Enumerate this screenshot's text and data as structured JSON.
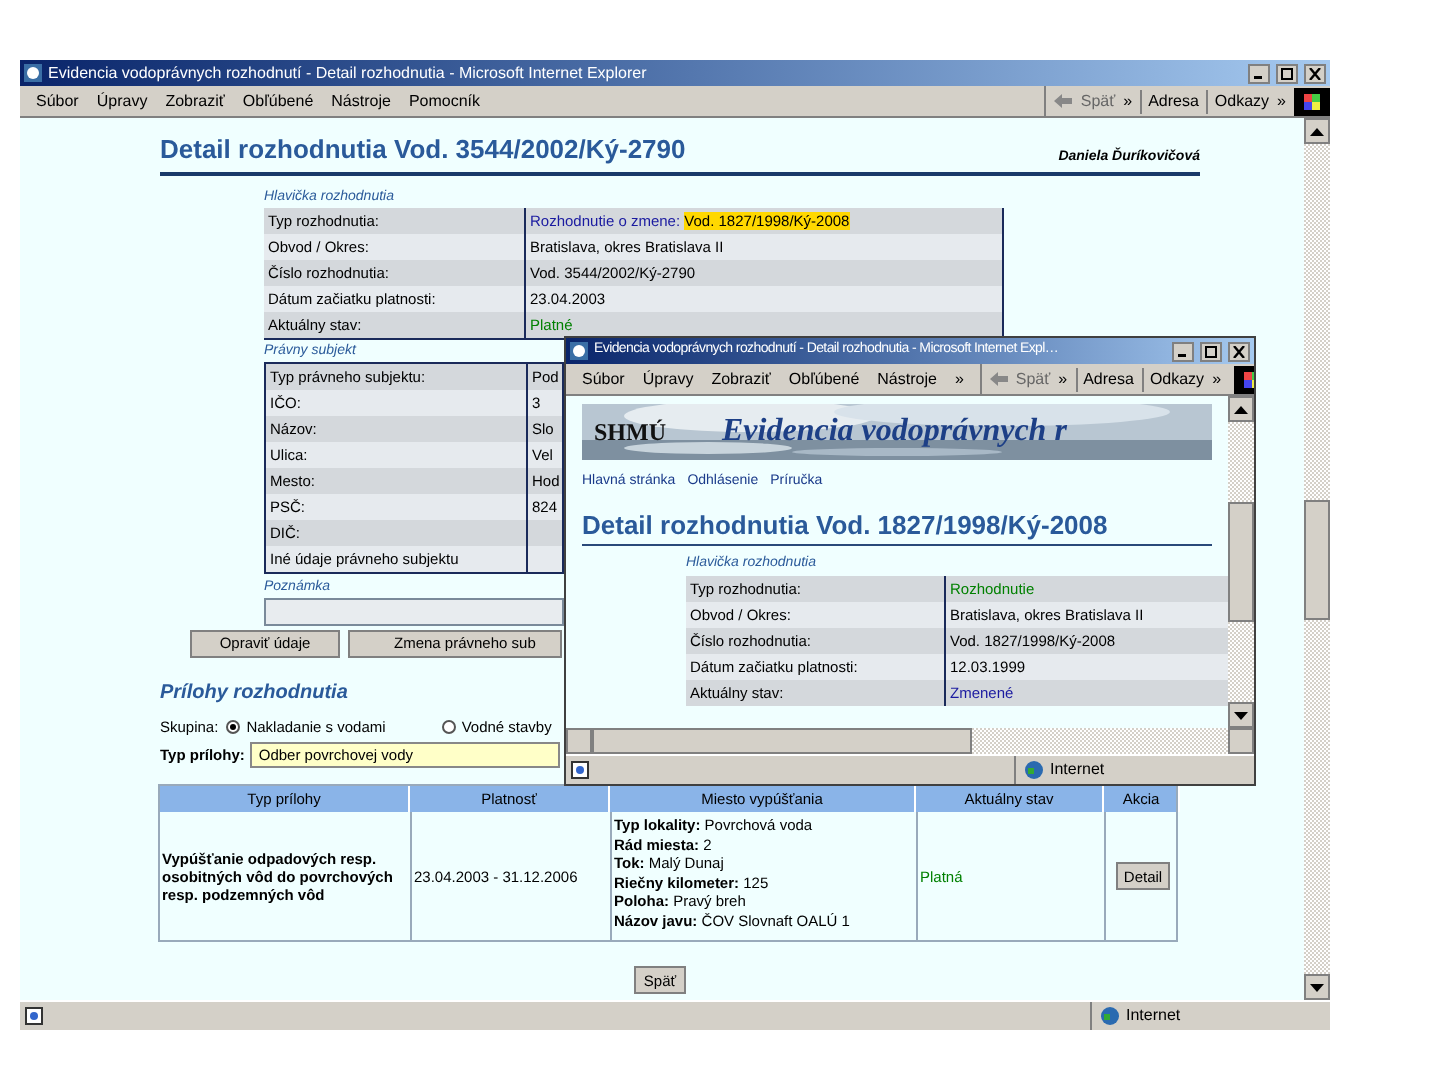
{
  "main_window": {
    "title": "Evidencia vodoprávnych rozhodnutí - Detail rozhodnutia - Microsoft Internet Explorer",
    "menu": [
      "Súbor",
      "Úpravy",
      "Zobraziť",
      "Obľúbené",
      "Nástroje",
      "Pomocník"
    ],
    "toolbar": {
      "back": "Späť",
      "back_more": "»",
      "address": "Adresa",
      "links": "Odkazy",
      "links_more": "»"
    },
    "heading": "Detail rozhodnutia Vod. 3544/2002/Ký-2790",
    "user": "Daniela Ďuríkovičová",
    "header_section": {
      "title": "Hlavička rozhodnutia",
      "rows": [
        {
          "label": "Typ rozhodnutia:",
          "value": "Rozhodnutie o zmene:",
          "highlight": "Vod. 1827/1998/Ký-2008",
          "color": "#1a1aa0"
        },
        {
          "label": "Obvod / Okres:",
          "value": "Bratislava, okres Bratislava II",
          "color": "#000000"
        },
        {
          "label": "Číslo rozhodnutia:",
          "value": "Vod. 3544/2002/Ký-2790",
          "color": "#000000"
        },
        {
          "label": "Dátum začiatku platnosti:",
          "value": "23.04.2003",
          "color": "#000000"
        },
        {
          "label": "Aktuálny stav:",
          "value": "Platné",
          "color": "#008000"
        }
      ]
    },
    "subject_section": {
      "title": "Právny subjekt",
      "rows": [
        {
          "label": "Typ právneho subjektu:",
          "value": "Pod"
        },
        {
          "label": "IČO:",
          "value": "3"
        },
        {
          "label": "Názov:",
          "value": "Slo"
        },
        {
          "label": "Ulica:",
          "value": "Vel"
        },
        {
          "label": "Mesto:",
          "value": "Hod"
        },
        {
          "label": "PSČ:",
          "value": "824"
        },
        {
          "label": "DIČ:"
        },
        {
          "label": "Iné údaje právneho subjektu"
        }
      ]
    },
    "note_label": "Poznámka",
    "buttons": [
      "Opraviť údaje",
      "Zmena právneho sub"
    ],
    "attachments_title": "Prílohy rozhodnutia",
    "group_label": "Skupina:",
    "groups": [
      {
        "label": "Nakladanie s vodami",
        "selected": true
      },
      {
        "label": "Vodné stavby",
        "selected": false
      }
    ],
    "type_label": "Typ prílohy:",
    "type_value": "Odber povrchovej vody",
    "table": {
      "columns": [
        "Typ prílohy",
        "Platnosť",
        "Miesto vypúšťania",
        "Aktuálny stav",
        "Akcia"
      ],
      "rows": [
        {
          "type": "Vypúšťanie odpadových resp. osobitných vôd do povrchových resp. podzemných vôd",
          "validity": "23.04.2003 - 31.12.2006",
          "place": [
            {
              "label": "Typ lokality:",
              "value": "Povrchová voda"
            },
            {
              "label": "Rád miesta:",
              "value": "2"
            },
            {
              "label": "Tok:",
              "value": "Malý Dunaj"
            },
            {
              "label": "Riečny kilometer:",
              "value": "125"
            },
            {
              "label": "Poloha:",
              "value": "Pravý breh"
            },
            {
              "label": "Názov javu:",
              "value": "ČOV Slovnaft OALÚ 1"
            }
          ],
          "status": "Platná",
          "action": "Detail"
        }
      ]
    },
    "back_button": "Späť",
    "status_zone": "Internet"
  },
  "popup_window": {
    "title": "Evidencia vodoprávnych rozhodnutí - Detail rozhodnutia - Microsoft Internet Expl…",
    "menu": [
      "Súbor",
      "Úpravy",
      "Zobraziť",
      "Obľúbené",
      "Nástroje",
      "»"
    ],
    "toolbar": {
      "back": "Späť",
      "back_more": "»",
      "address": "Adresa",
      "links": "Odkazy",
      "links_more": "»"
    },
    "logo": "SHMÚ",
    "banner": "Evidencia vodoprávnych r",
    "nav": [
      "Hlavná stránka",
      "Odhlásenie",
      "Príručka"
    ],
    "heading": "Detail rozhodnutia Vod. 1827/1998/Ký-2008",
    "section_title": "Hlavička rozhodnutia",
    "rows": [
      {
        "label": "Typ rozhodnutia:",
        "value": "Rozhodnutie",
        "color": "#008000"
      },
      {
        "label": "Obvod / Okres:",
        "value": "Bratislava, okres Bratislava II",
        "color": "#000000"
      },
      {
        "label": "Číslo rozhodnutia:",
        "value": "Vod. 1827/1998/Ký-2008",
        "color": "#000000"
      },
      {
        "label": "Dátum začiatku platnosti:",
        "value": "12.03.1999",
        "color": "#000000"
      },
      {
        "label": "Aktuálny stav:",
        "value": "Zmenené",
        "color": "#1a1aa0"
      }
    ],
    "status_zone": "Internet"
  }
}
